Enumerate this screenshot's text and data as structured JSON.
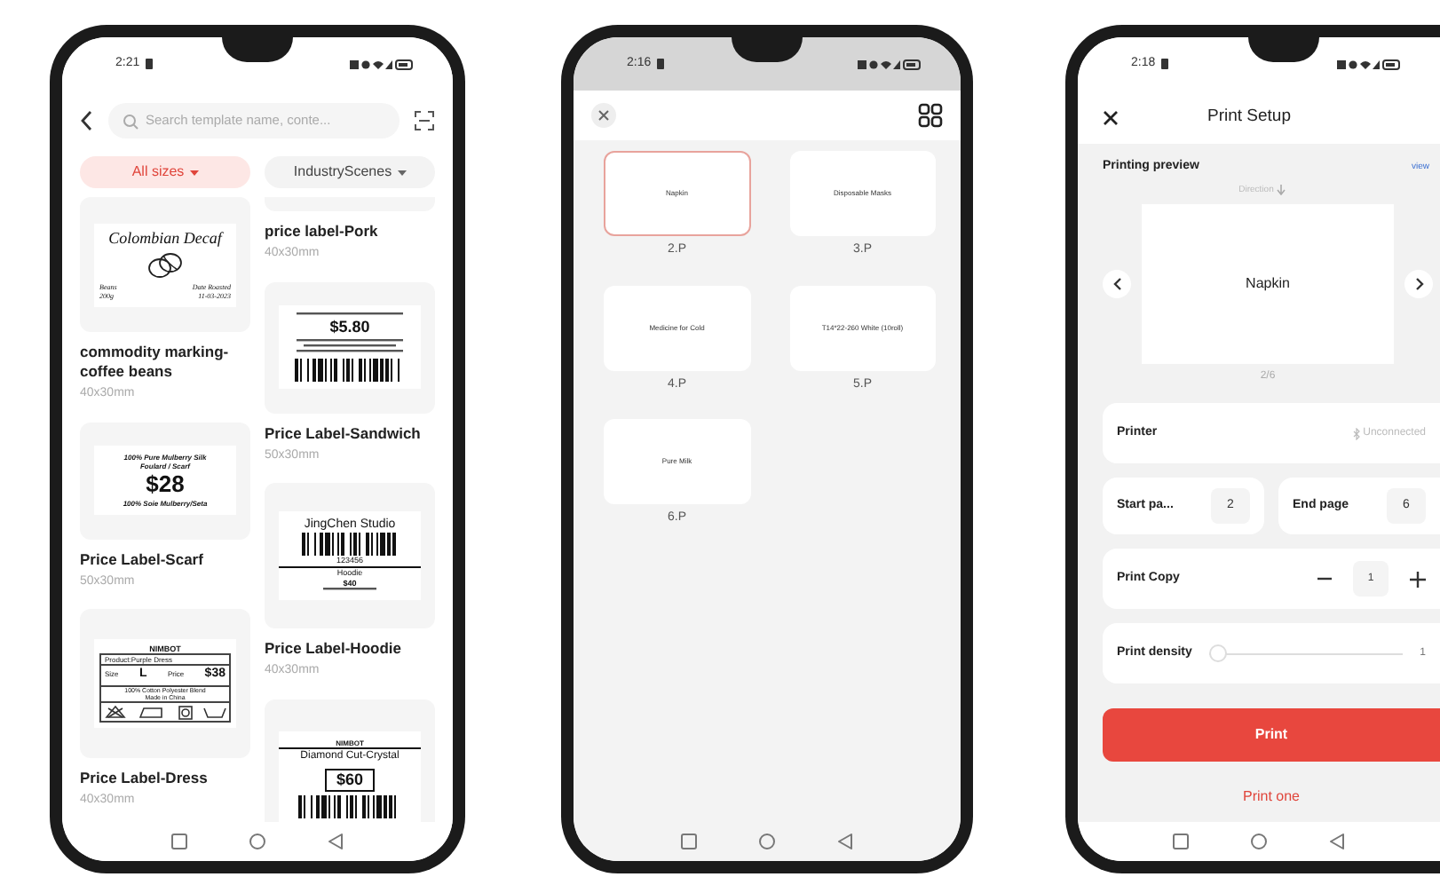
{
  "template_screen": {
    "status_time": "2:21",
    "search": {
      "placeholder": "Search template name, conte..."
    },
    "filters": [
      {
        "label": "All sizes",
        "selected": true
      },
      {
        "label": "IndustryScenes",
        "selected": false
      }
    ],
    "columns": [
      [
        {
          "title": "commodity marking-coffee beans",
          "size": "40x30mm",
          "label": {
            "kind": "coffee",
            "texts": [
              "Colombian Decaf",
              "Beans",
              "200g",
              "Date Roasted",
              "11-03-2023"
            ]
          }
        },
        {
          "title": "Price Label-Scarf",
          "size": "50x30mm",
          "label": {
            "kind": "scarf",
            "texts": [
              "100% Pure Mulberry Silk",
              "Foulard / Scarf",
              "$28",
              "100% Soie Mulberry/Seta"
            ]
          }
        },
        {
          "title": "Price Label-Dress",
          "size": "40x30mm",
          "label": {
            "kind": "dress",
            "texts": [
              "NIMBOT",
              "Product:Purple Dress",
              "Size",
              "L",
              "Price",
              "$38",
              "100% Cotton Polyester Blend",
              "Made in China"
            ]
          }
        }
      ],
      [
        {
          "title": "price label-Pork",
          "size": "40x30mm"
        },
        {
          "title": "Price Label-Sandwich",
          "size": "50x30mm",
          "label": {
            "kind": "sandwich",
            "texts": [
              "$5.80"
            ]
          }
        },
        {
          "title": "Price Label-Hoodie",
          "size": "40x30mm",
          "label": {
            "kind": "hoodie",
            "texts": [
              "JingChen Studio",
              "123456",
              "Hoodie",
              "$40"
            ]
          }
        },
        {
          "label": {
            "kind": "crystal",
            "texts": [
              "NIMBOT",
              "Diamond Cut-Crystal",
              "$60"
            ]
          }
        }
      ]
    ]
  },
  "pages_screen": {
    "status_time": "2:16",
    "pages": [
      {
        "label": "Napkin",
        "number": "2.P",
        "selected": true
      },
      {
        "label": "Disposable Masks",
        "number": "3.P",
        "selected": false
      },
      {
        "label": "Medicine for Cold",
        "number": "4.P",
        "selected": false
      },
      {
        "label": "T14*22-260 White (10roll)",
        "number": "5.P",
        "selected": false
      },
      {
        "label": "Pure Milk",
        "number": "6.P",
        "selected": false
      }
    ]
  },
  "print_screen": {
    "status_time": "2:18",
    "title": "Print Setup",
    "preview": {
      "heading": "Printing preview",
      "link": "view",
      "direction": "Direction",
      "label": "Napkin",
      "counter": "2/6"
    },
    "printer": {
      "label": "Printer",
      "status": "Unconnected"
    },
    "start_page": {
      "label": "Start pa...",
      "value": "2"
    },
    "end_page": {
      "label": "End page",
      "value": "6"
    },
    "copies": {
      "label": "Print Copy",
      "value": "1"
    },
    "density": {
      "label": "Print density",
      "level": 0,
      "reading": "1"
    },
    "print_button": "Print",
    "print_one": "Print one"
  }
}
